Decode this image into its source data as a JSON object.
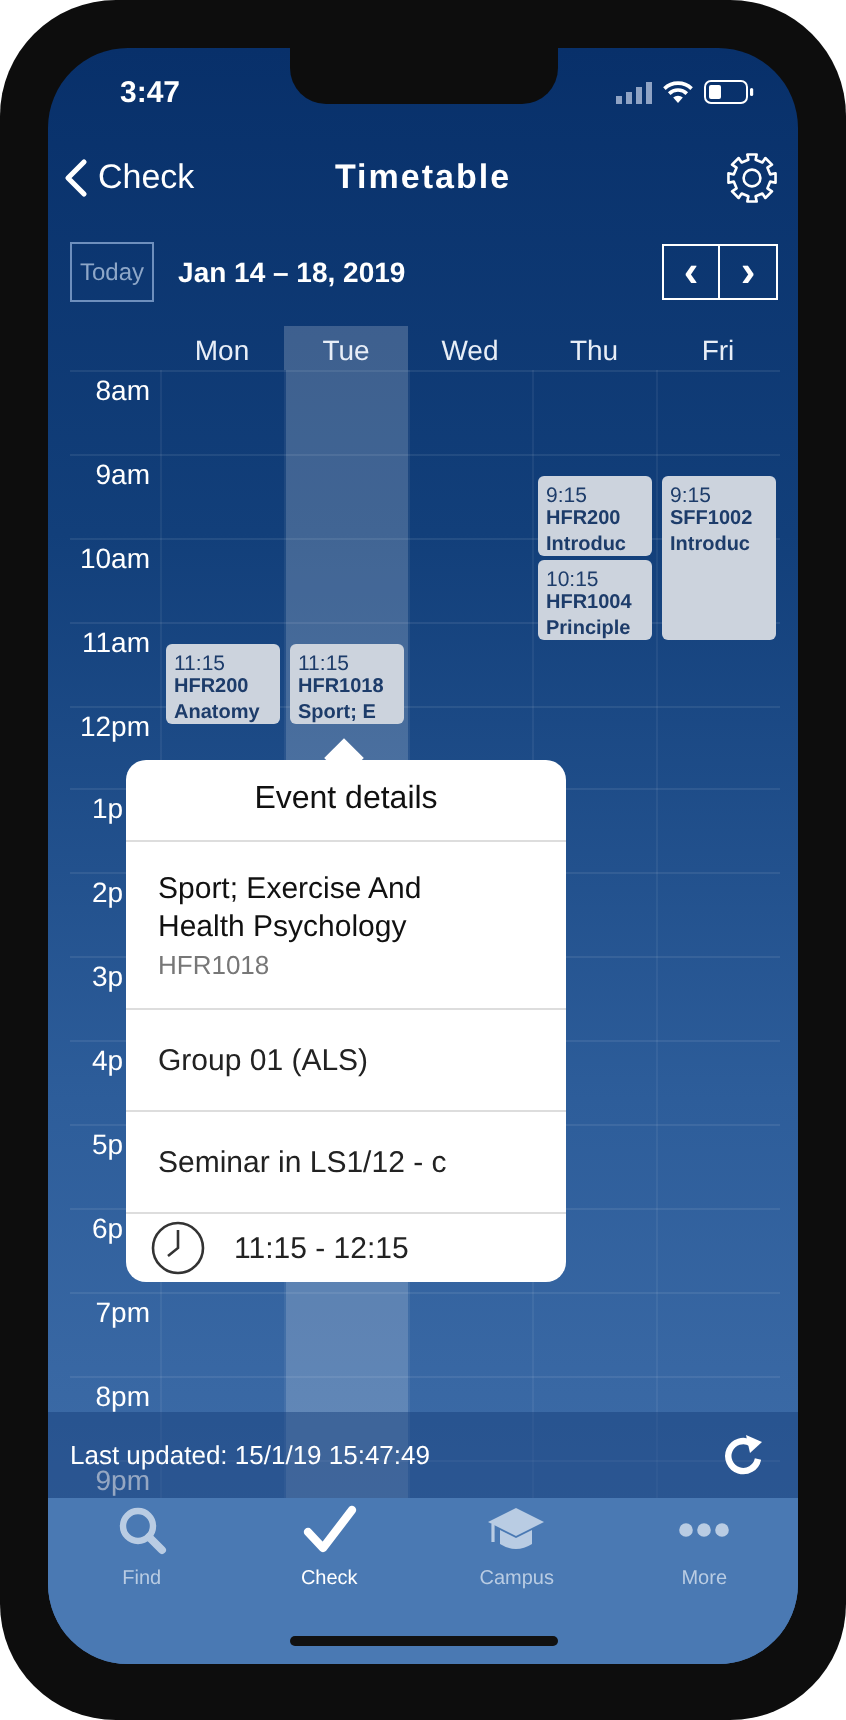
{
  "status_bar": {
    "time": "3:47"
  },
  "nav": {
    "back": "Check",
    "title": "Timetable"
  },
  "toolbar": {
    "today": "Today",
    "range": "Jan 14 – 18, 2019",
    "prev": "‹",
    "next": "›"
  },
  "days": [
    {
      "label": "Mon",
      "selected": false,
      "events": [
        {
          "time": "11:15",
          "code": "HFR200",
          "title": "Anatomy",
          "kind": "one-hour"
        }
      ]
    },
    {
      "label": "Tue",
      "selected": true,
      "events": [
        {
          "time": "11:15",
          "code": "HFR1018",
          "title": "Sport; E",
          "kind": "one-hour"
        }
      ]
    },
    {
      "label": "Wed",
      "selected": false
    },
    {
      "label": "Thu",
      "selected": false,
      "events": [
        {
          "time": "9:15",
          "code": "HFR200",
          "title": "Introduc",
          "kind": "one-hour"
        },
        {
          "time": "10:15",
          "code": "HFR1004",
          "title": "Principle",
          "kind": "one-hour"
        }
      ]
    },
    {
      "label": "Fri",
      "selected": false,
      "events": [
        {
          "time": "9:15",
          "code": "SFF1002",
          "title": "Introduc",
          "kind": "two-hour"
        }
      ]
    }
  ],
  "hours": [
    {
      "label": "8am",
      "kind": "full"
    },
    {
      "label": "9am",
      "kind": "full"
    },
    {
      "label": "10am",
      "kind": "full"
    },
    {
      "label": "11am",
      "kind": "full"
    },
    {
      "label": "12pm",
      "kind": "full"
    },
    {
      "label": "1p",
      "kind": "cut"
    },
    {
      "label": "2p",
      "kind": "cut"
    },
    {
      "label": "3p",
      "kind": "cut"
    },
    {
      "label": "4p",
      "kind": "cut"
    },
    {
      "label": "5p",
      "kind": "cut"
    },
    {
      "label": "6p",
      "kind": "cut"
    },
    {
      "label": "7pm",
      "kind": "full"
    },
    {
      "label": "8pm",
      "kind": "full"
    },
    {
      "label": "9pm",
      "kind": "full"
    }
  ],
  "popup": {
    "title": "Event details",
    "name": "Sport; Exercise And Health Psychology",
    "code": "HFR1018",
    "group": "Group 01 (ALS)",
    "location": "Seminar in LS1/12 - c",
    "time": "11:15 - 12:15"
  },
  "last_updated": "Last updated: 15/1/19 15:47:49",
  "tabs": [
    {
      "label": "Find",
      "selected": false
    },
    {
      "label": "Check",
      "selected": true
    },
    {
      "label": "Campus",
      "selected": false
    },
    {
      "label": "More",
      "selected": false
    }
  ]
}
